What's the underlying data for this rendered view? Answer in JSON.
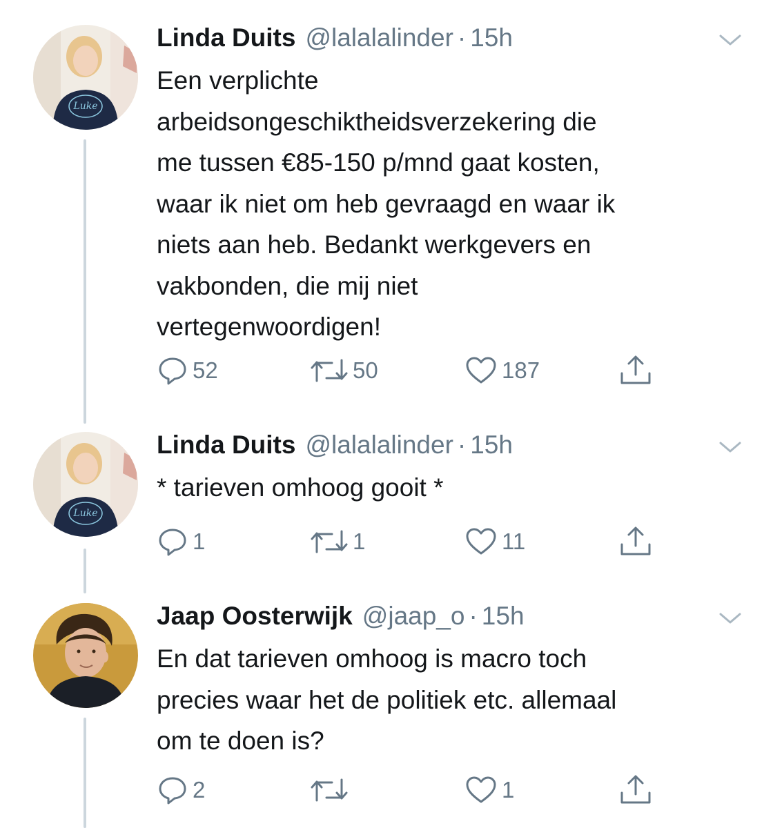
{
  "colors": {
    "text": "#14171a",
    "secondary": "#657786",
    "thread_line": "#ccd6dd",
    "background": "#ffffff"
  },
  "tweets": [
    {
      "author_name": "Linda Duits",
      "author_handle": "@lalalalinder",
      "dot": "·",
      "time": "15h",
      "text_lines": [
        "Een verplichte",
        "arbeidsongeschiktheidsverzekering die",
        "me tussen €85-150 p/mnd gaat kosten,",
        "waar ik niet om heb gevraagd en waar ik",
        "niets aan heb. Bedankt werkgevers en",
        "vakbonden, die mij niet",
        "vertegenwoordigen!"
      ],
      "reply_count": "52",
      "retweet_count": "50",
      "like_count": "187",
      "avatar_icon": "profile-photo-woman-icon"
    },
    {
      "author_name": "Linda Duits",
      "author_handle": "@lalalalinder",
      "dot": "·",
      "time": "15h",
      "text_lines": [
        "* tarieven omhoog gooit *"
      ],
      "reply_count": "1",
      "retweet_count": "1",
      "like_count": "11",
      "avatar_icon": "profile-photo-woman-icon"
    },
    {
      "author_name": "Jaap Oosterwijk",
      "author_handle": "@jaap_o",
      "dot": "·",
      "time": "15h",
      "text_lines": [
        "En dat tarieven omhoog is macro toch",
        "precies waar het de politiek etc. allemaal",
        "om te doen is?"
      ],
      "reply_count": "2",
      "retweet_count": "",
      "like_count": "1",
      "avatar_icon": "profile-photo-man-icon"
    }
  ],
  "icons": {
    "reply": "reply-icon",
    "retweet": "retweet-icon",
    "like": "heart-icon",
    "share": "share-icon",
    "menu": "chevron-down-icon"
  }
}
